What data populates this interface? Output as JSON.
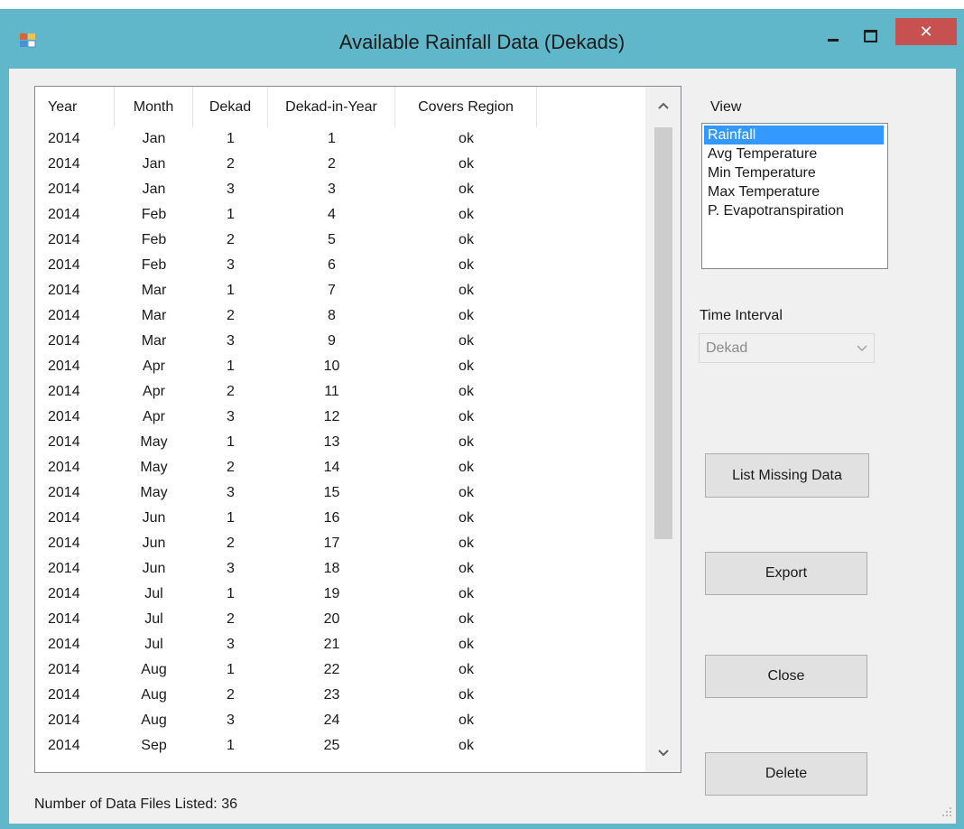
{
  "window": {
    "title": "Available Rainfall Data (Dekads)",
    "close_glyph": "✕"
  },
  "table": {
    "columns": [
      "Year",
      "Month",
      "Dekad",
      "Dekad-in-Year",
      "Covers Region"
    ],
    "rows": [
      [
        "2014",
        "Jan",
        "1",
        "1",
        "ok"
      ],
      [
        "2014",
        "Jan",
        "2",
        "2",
        "ok"
      ],
      [
        "2014",
        "Jan",
        "3",
        "3",
        "ok"
      ],
      [
        "2014",
        "Feb",
        "1",
        "4",
        "ok"
      ],
      [
        "2014",
        "Feb",
        "2",
        "5",
        "ok"
      ],
      [
        "2014",
        "Feb",
        "3",
        "6",
        "ok"
      ],
      [
        "2014",
        "Mar",
        "1",
        "7",
        "ok"
      ],
      [
        "2014",
        "Mar",
        "2",
        "8",
        "ok"
      ],
      [
        "2014",
        "Mar",
        "3",
        "9",
        "ok"
      ],
      [
        "2014",
        "Apr",
        "1",
        "10",
        "ok"
      ],
      [
        "2014",
        "Apr",
        "2",
        "11",
        "ok"
      ],
      [
        "2014",
        "Apr",
        "3",
        "12",
        "ok"
      ],
      [
        "2014",
        "May",
        "1",
        "13",
        "ok"
      ],
      [
        "2014",
        "May",
        "2",
        "14",
        "ok"
      ],
      [
        "2014",
        "May",
        "3",
        "15",
        "ok"
      ],
      [
        "2014",
        "Jun",
        "1",
        "16",
        "ok"
      ],
      [
        "2014",
        "Jun",
        "2",
        "17",
        "ok"
      ],
      [
        "2014",
        "Jun",
        "3",
        "18",
        "ok"
      ],
      [
        "2014",
        "Jul",
        "1",
        "19",
        "ok"
      ],
      [
        "2014",
        "Jul",
        "2",
        "20",
        "ok"
      ],
      [
        "2014",
        "Jul",
        "3",
        "21",
        "ok"
      ],
      [
        "2014",
        "Aug",
        "1",
        "22",
        "ok"
      ],
      [
        "2014",
        "Aug",
        "2",
        "23",
        "ok"
      ],
      [
        "2014",
        "Aug",
        "3",
        "24",
        "ok"
      ],
      [
        "2014",
        "Sep",
        "1",
        "25",
        "ok"
      ]
    ]
  },
  "view": {
    "label": "View",
    "items": [
      "Rainfall",
      "Avg Temperature",
      "Min Temperature",
      "Max Temperature",
      "P. Evapotranspiration"
    ],
    "selected_index": 0
  },
  "time_interval": {
    "label": "Time Interval",
    "value": "Dekad"
  },
  "buttons": {
    "list_missing": "List Missing Data",
    "export": "Export",
    "close": "Close",
    "delete": "Delete"
  },
  "status": {
    "files_listed": "Number of Data Files Listed: 36"
  },
  "colors": {
    "titlebar": "#5fb7c9",
    "close_button": "#c75050",
    "selection": "#3399ff",
    "panel": "#f0f0f0"
  },
  "icons": [
    "app-icon",
    "minimize-icon",
    "maximize-icon",
    "close-icon",
    "scroll-up-icon",
    "scroll-down-icon",
    "dropdown-arrow-icon",
    "size-grip-icon"
  ]
}
